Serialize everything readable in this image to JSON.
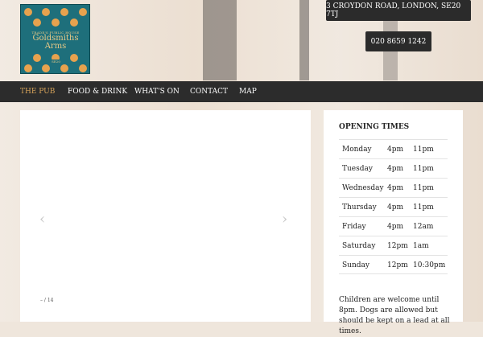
{
  "logo": {
    "top_text": "TRADE'S PUBLIC HOUSE",
    "name_line1": "Goldsmiths",
    "name_line2": "Arms",
    "foot_text": "SE20",
    "colors": {
      "background": "#1e6f7b",
      "motif": "#e7a24e",
      "text": "#e7c886"
    }
  },
  "header": {
    "address": "3 CROYDON ROAD, LONDON, SE20 7TJ",
    "phone": "020 8659 1242"
  },
  "nav": {
    "items": [
      {
        "label": "THE PUB",
        "active": true
      },
      {
        "label": "FOOD & DRINK",
        "active": false
      },
      {
        "label": "WHAT'S ON",
        "active": false
      },
      {
        "label": "CONTACT",
        "active": false
      },
      {
        "label": "MAP",
        "active": false
      }
    ]
  },
  "slider": {
    "prev_icon": "chevron-left-icon",
    "next_icon": "chevron-right-icon",
    "counter": "– / 14"
  },
  "opening_times": {
    "title": "OPENING TIMES",
    "rows": [
      {
        "day": "Monday",
        "open": "4pm",
        "close": "11pm"
      },
      {
        "day": "Tuesday",
        "open": "4pm",
        "close": "11pm"
      },
      {
        "day": "Wednesday",
        "open": "4pm",
        "close": "11pm"
      },
      {
        "day": "Thursday",
        "open": "4pm",
        "close": "11pm"
      },
      {
        "day": "Friday",
        "open": "4pm",
        "close": "12am"
      },
      {
        "day": "Saturday",
        "open": "12pm",
        "close": "1am"
      },
      {
        "day": "Sunday",
        "open": "12pm",
        "close": "10:30pm"
      }
    ],
    "note": "Children are welcome until 8pm. Dogs are allowed but should be kept on a lead at all times."
  },
  "colors": {
    "nav_bg": "#2c2c2c",
    "nav_active": "#d7a35a",
    "pill_bg": "#2b2b2b"
  }
}
